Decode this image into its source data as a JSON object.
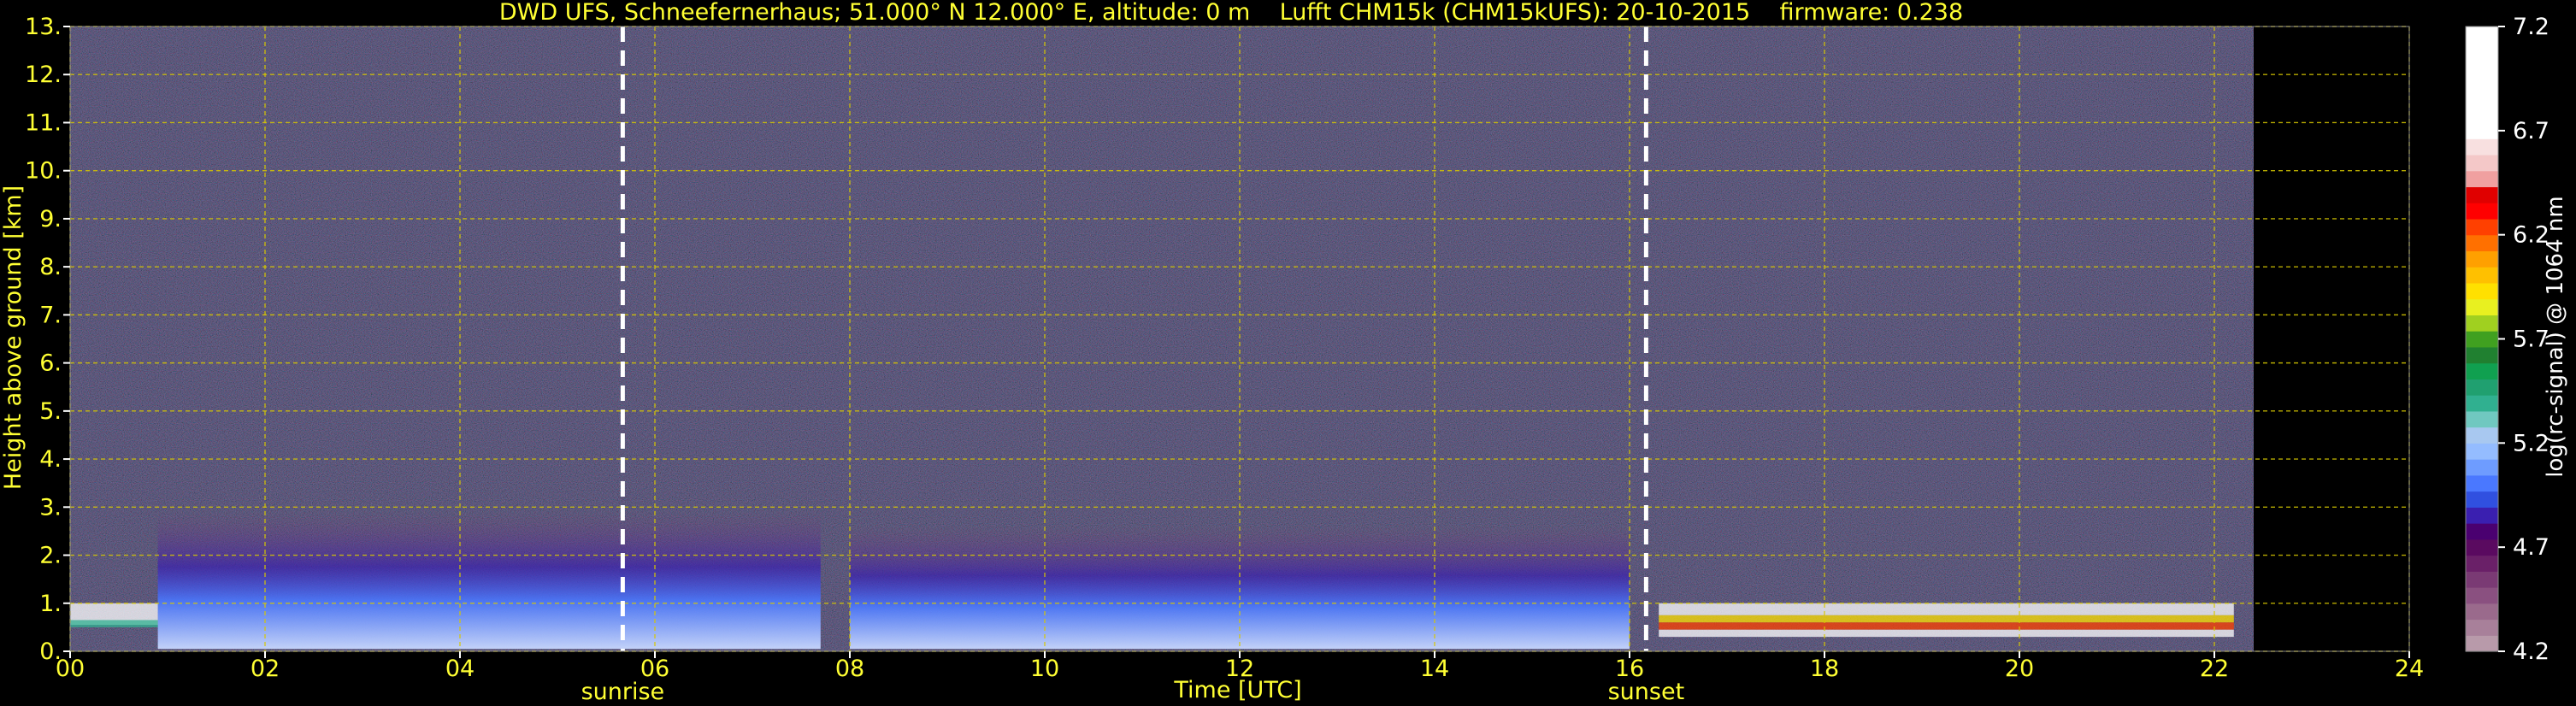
{
  "chart_data": {
    "type": "heatmap",
    "title": "DWD UFS, Schneefernerhaus; 51.000° N 12.000° E, altitude: 0 m    Lufft CHM15k (CHM15kUFS): 20-10-2015    firmware: 0.238",
    "xlabel": "Time [UTC]",
    "ylabel": "Height above ground [km]",
    "xlim": [
      0,
      24
    ],
    "ylim": [
      0,
      13
    ],
    "x_ticks": [
      "00",
      "02",
      "04",
      "06",
      "08",
      "10",
      "12",
      "14",
      "16",
      "18",
      "20",
      "22",
      "24"
    ],
    "y_ticks": [
      "0.",
      "1.",
      "2.",
      "3.",
      "4.",
      "5.",
      "6.",
      "7.",
      "8.",
      "9.",
      "10.",
      "11.",
      "12.",
      "13."
    ],
    "grid": true,
    "data_end_hour": 22.4,
    "events": [
      {
        "label": "sunrise",
        "hour": 5.67
      },
      {
        "label": "sunset",
        "hour": 16.17
      }
    ],
    "colorbar": {
      "label": "log(rc-signal) @ 1064 nm",
      "range": [
        4.2,
        7.2
      ],
      "ticks": [
        "4.2",
        "4.7",
        "5.2",
        "5.7",
        "6.2",
        "6.7",
        "7.2"
      ],
      "colors": [
        "#b89aaa",
        "#a8809a",
        "#9a6a8c",
        "#8a5080",
        "#7a3a74",
        "#6a2068",
        "#5a0a60",
        "#4a0070",
        "#3a1fb0",
        "#3050e0",
        "#4a78ff",
        "#6e9cff",
        "#94bcff",
        "#a8c8f0",
        "#70c8c0",
        "#30b090",
        "#20a070",
        "#10a050",
        "#208030",
        "#40a020",
        "#a0d020",
        "#e8f020",
        "#ffe000",
        "#ffc000",
        "#ffa000",
        "#ff7000",
        "#ff4000",
        "#ff0000",
        "#e00000",
        "#f0a0a0",
        "#f4c8c8",
        "#f8e0e0",
        "#ffffff",
        "#ffffff",
        "#ffffff",
        "#ffffff",
        "#ffffff",
        "#ffffff",
        "#ffffff"
      ]
    }
  }
}
